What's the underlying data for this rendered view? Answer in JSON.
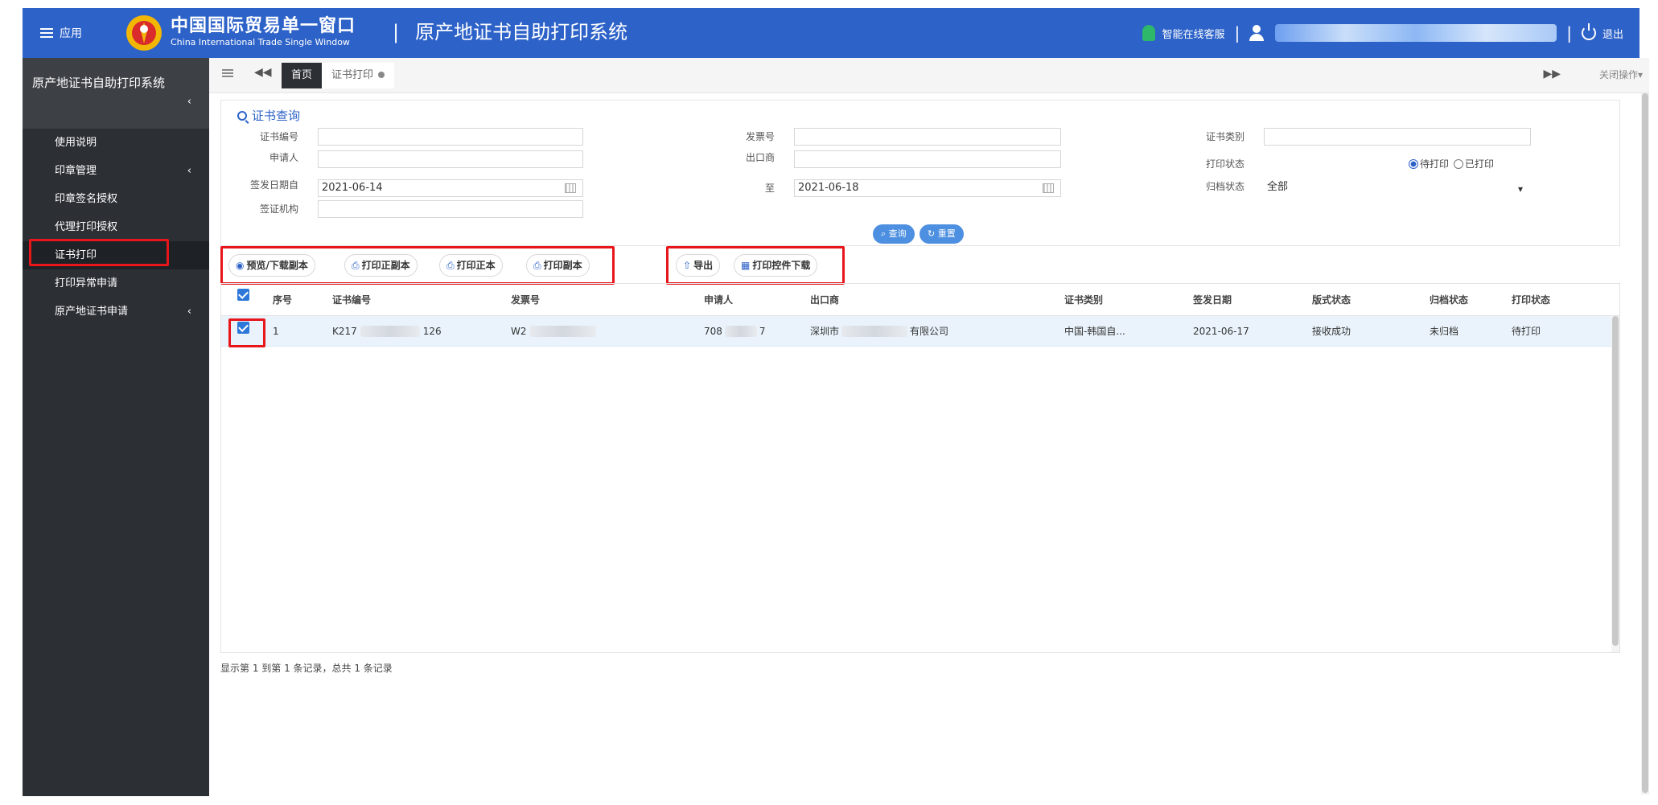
{
  "header": {
    "app_menu": "应用",
    "brand_cn": "中国国际贸易单一窗口",
    "brand_en": "China International Trade Single Window",
    "system_title": "原产地证书自助打印系统",
    "service": "智能在线客服",
    "logout": "退出",
    "colors": {
      "header_bg": "#2d62c8",
      "sidebar_bg": "#2c3035",
      "highlight": "#e8151b"
    },
    "icons": [
      "menu-icon",
      "logo-icon",
      "robot-icon",
      "user-icon",
      "power-icon"
    ]
  },
  "sidebar": {
    "title": "原产地证书自助打印系统",
    "collapse": "‹",
    "items": [
      {
        "label": "使用说明",
        "chevron": ""
      },
      {
        "label": "印章管理",
        "chevron": "‹"
      },
      {
        "label": "印章签名授权",
        "chevron": ""
      },
      {
        "label": "代理打印授权",
        "chevron": ""
      },
      {
        "label": "证书打印",
        "chevron": ""
      },
      {
        "label": "打印异常申请",
        "chevron": ""
      },
      {
        "label": "原产地证书申请",
        "chevron": "‹"
      }
    ]
  },
  "tabs": {
    "back": "◀◀",
    "home": "首页",
    "current": "证书打印",
    "forward": "▶▶",
    "close_ops": "关闭操作▾"
  },
  "search": {
    "title": "证书查询",
    "labels": {
      "cert_no": "证书编号",
      "invoice_no": "发票号",
      "cert_type": "证书类别",
      "applicant": "申请人",
      "exporter": "出口商",
      "print_status": "打印状态",
      "issue_date_from": "签发日期自",
      "to": "至",
      "archive_status": "归档状态",
      "issuing_agency": "签证机构"
    },
    "values": {
      "issue_date_from": "2021-06-14",
      "issue_date_to": "2021-06-18",
      "archive_status": "全部"
    },
    "print_status_options": [
      "待打印",
      "已打印"
    ],
    "print_status_selected": "待打印",
    "query_btn": "查询",
    "reset_btn": "重置"
  },
  "toolbar": {
    "preview": "预览/下载副本",
    "print_both": "打印正副本",
    "print_original": "打印正本",
    "print_copy": "打印副本",
    "export": "导出",
    "plugin_download": "打印控件下载"
  },
  "table": {
    "headers": [
      "序号",
      "证书编号",
      "发票号",
      "申请人",
      "出口商",
      "证书类别",
      "签发日期",
      "版式状态",
      "归档状态",
      "打印状态"
    ],
    "rows": [
      {
        "seq": "1",
        "cert_no_prefix": "K217",
        "cert_no_suffix": "126",
        "invoice_prefix": "W2",
        "applicant_prefix": "708",
        "applicant_suffix": "7",
        "exporter_prefix": "深圳市",
        "exporter_suffix": "有限公司",
        "cert_type": "中国-韩国自...",
        "issue_date": "2021-06-17",
        "format_status": "接收成功",
        "archive_status": "未归档",
        "print_status": "待打印"
      }
    ]
  },
  "footer": {
    "info": "显示第 1 到第 1 条记录，总共 1 条记录"
  }
}
